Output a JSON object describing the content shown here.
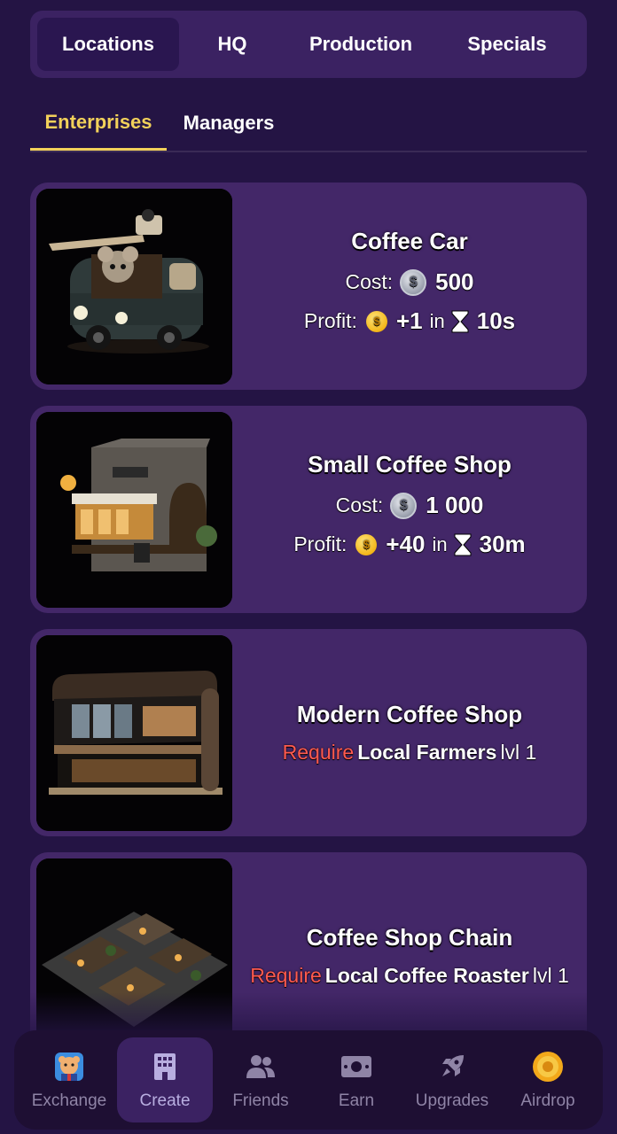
{
  "top_tabs": [
    "Locations",
    "HQ",
    "Production",
    "Specials"
  ],
  "sub_tabs": [
    "Enterprises",
    "Managers"
  ],
  "cards": [
    {
      "title": "Coffee Car",
      "cost_label": "Cost:",
      "cost_value": "500",
      "profit_label": "Profit:",
      "profit_value": "+1",
      "in_label": "in",
      "time": "10s"
    },
    {
      "title": "Small Coffee Shop",
      "cost_label": "Cost:",
      "cost_value": "1 000",
      "profit_label": "Profit:",
      "profit_value": "+40",
      "in_label": "in",
      "time": "30m"
    },
    {
      "title": "Modern Coffee Shop",
      "require_word": "Require",
      "require_target": "Local Farmers",
      "require_level": "lvl 1"
    },
    {
      "title": "Coffee Shop Chain",
      "require_word": "Require",
      "require_target": "Local Coffee Roaster",
      "require_level": "lvl 1"
    }
  ],
  "nav": [
    {
      "label": "Exchange",
      "icon": "hamster-avatar-icon"
    },
    {
      "label": "Create",
      "icon": "building-icon",
      "active": true
    },
    {
      "label": "Friends",
      "icon": "friends-icon"
    },
    {
      "label": "Earn",
      "icon": "money-icon"
    },
    {
      "label": "Upgrades",
      "icon": "rocket-icon"
    },
    {
      "label": "Airdrop",
      "icon": "airdrop-coin-icon"
    }
  ],
  "colors": {
    "background": "#241444",
    "card": "#432768",
    "accent_yellow": "#f2d15a",
    "require_red": "#ff5a4e"
  }
}
